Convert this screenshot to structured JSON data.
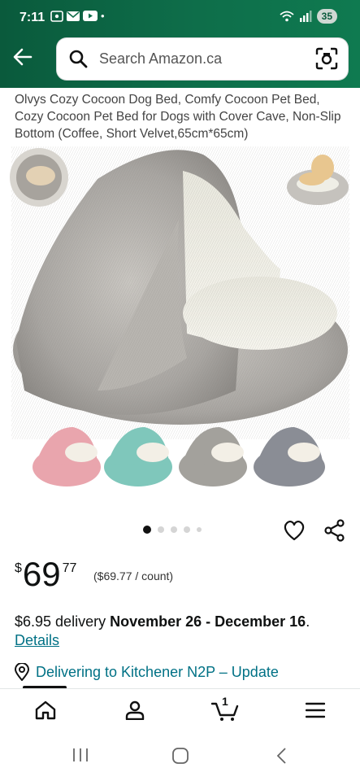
{
  "status_bar": {
    "time": "7:11",
    "battery": "35",
    "dot": "•"
  },
  "search": {
    "placeholder": "Search Amazon.ca",
    "icons": [
      "search-icon",
      "camera-scan-icon"
    ]
  },
  "product": {
    "title": "Olvys Cozy Cocoon Dog Bed, Comfy Cocoon Pet Bed, Cozy Cocoon Pet Bed for Dogs with Cover Cave, Non-Slip Bottom (Coffee, Short Velvet,65cm*65cm)",
    "price_currency": "$",
    "price_dollars": "69",
    "price_cents": "77",
    "unit_price": "($69.77 / count)",
    "delivery_prefix": "$6.95 delivery ",
    "delivery_dates": "November 26 - December 16",
    "delivery_suffix": ".",
    "details_link": "Details",
    "deliver_to": "Delivering to Kitchener N2P – Update"
  },
  "gallery": {
    "colors": {
      "main_fur": "#a9a6a2",
      "inner": "#efeee6",
      "pink": "#e9a5ad",
      "teal": "#7fc7bb",
      "grey": "#a3a19c",
      "charcoal": "#8a8d95"
    },
    "current_image": 1,
    "total_dots": 5
  },
  "bottom_nav": {
    "items": [
      "home-icon",
      "account-icon",
      "cart-icon",
      "menu-icon"
    ],
    "cart_count": "1"
  },
  "colors": {
    "header_green": "#0e6e4a",
    "link": "#007185"
  }
}
